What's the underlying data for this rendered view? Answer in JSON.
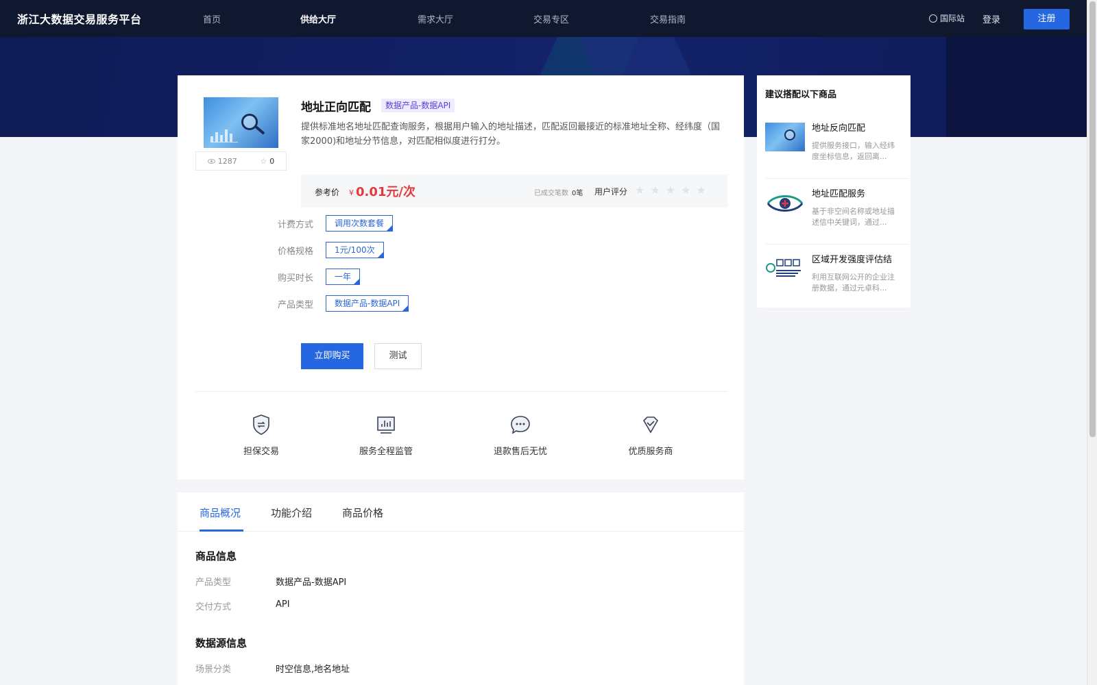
{
  "header": {
    "logo": "浙江大数据交易服务平台",
    "nav": [
      "首页",
      "供给大厅",
      "需求大厅",
      "交易专区",
      "交易指南"
    ],
    "intl": "国际站",
    "login": "登录",
    "register": "注册"
  },
  "product": {
    "title": "地址正向匹配",
    "tag": "数据产品-数据API",
    "description": "提供标准地名地址匹配查询服务，根据用户输入的地址描述，匹配返回最接近的标准地址全称、经纬度（国家2000)和地址分节信息，对匹配相似度进行打分。",
    "views": "1287",
    "favorites": "0",
    "price_label": "参考价",
    "price_currency": "¥",
    "price_value": "0.01元/次",
    "deals_label": "已成交笔数",
    "deals_count": "0笔",
    "rating_label": "用户评分",
    "rating": 0,
    "specs": [
      {
        "label": "计费方式",
        "value": "调用次数套餐"
      },
      {
        "label": "价格规格",
        "value": "1元/100次"
      },
      {
        "label": "购买时长",
        "value": "一年"
      },
      {
        "label": "产品类型",
        "value": "数据产品-数据API"
      }
    ],
    "buy_button": "立即购买",
    "test_button": "测试",
    "features": [
      "担保交易",
      "服务全程监管",
      "退款售后无忧",
      "优质服务商"
    ]
  },
  "sidebar": {
    "title": "建议搭配以下商品",
    "items": [
      {
        "name": "地址反向匹配",
        "desc": "提供服务接口，输入经纬度坐标信息，返回离..."
      },
      {
        "name": "地址匹配服务",
        "desc": "基于非空间名称或地址描述信中关键词，通过..."
      },
      {
        "name": "区域开发强度评估结",
        "desc": "利用互联网公开的企业注册数据，通过元卓科..."
      }
    ]
  },
  "tabs": {
    "items": [
      "商品概况",
      "功能介绍",
      "商品价格"
    ],
    "active": "商品概况"
  },
  "details": {
    "info_title": "商品信息",
    "product_type_label": "产品类型",
    "product_type_value": "数据产品-数据API",
    "delivery_label": "交付方式",
    "delivery_value": "API",
    "source_title": "数据源信息",
    "scene_label": "场景分类",
    "scene_value": "时空信息,地名地址"
  },
  "colors": {
    "brand": "#2467e0",
    "price": "#e23a3a",
    "nav_bg": "#101830",
    "tag_text": "#5a3dd8"
  }
}
